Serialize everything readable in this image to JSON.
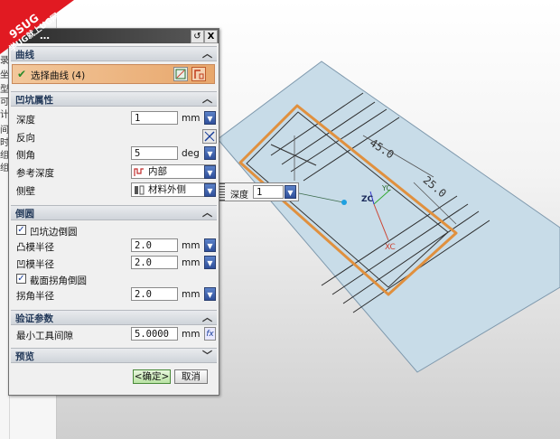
{
  "dialog": {
    "title": "…",
    "close_label": "X",
    "reset_label": "↺",
    "sections": {
      "curve": {
        "label": "曲线"
      },
      "properties": {
        "label": "凹坑属性"
      },
      "fillet": {
        "label": "倒圆"
      },
      "verify": {
        "label": "验证参数"
      },
      "preview": {
        "label": "预览"
      }
    },
    "select_curve": {
      "label": "选择曲线 (4)"
    },
    "depth": {
      "label": "深度",
      "value": "1",
      "unit": "mm"
    },
    "reverse": {
      "label": "反向"
    },
    "side_angle": {
      "label": "侧角",
      "value": "5",
      "unit": "deg"
    },
    "ref_depth": {
      "label": "参考深度",
      "value": "内部"
    },
    "side_wall": {
      "label": "侧壁",
      "value": "材料外侧"
    },
    "fillet_edges": {
      "label": "凹坑边倒圆",
      "checked": true
    },
    "punch_radius": {
      "label": "凸模半径",
      "value": "2.0",
      "unit": "mm"
    },
    "die_radius": {
      "label": "凹模半径",
      "value": "2.0",
      "unit": "mm"
    },
    "fillet_corners": {
      "label": "截面拐角倒圆",
      "checked": true
    },
    "corner_radius": {
      "label": "拐角半径",
      "value": "2.0",
      "unit": "mm"
    },
    "min_clearance": {
      "label": "最小工具间隙",
      "value": "5.0000",
      "unit": "mm"
    },
    "ok_label": "<确定>",
    "cancel_label": "取消"
  },
  "depth_popup": {
    "label": "深度",
    "value": "1"
  },
  "viewport": {
    "dim_length": "45.0",
    "dim_width": "25.0",
    "axis_zc": "ZC",
    "axis_yc": "YC",
    "axis_xc": "XC"
  },
  "left_panel": {
    "chars": [
      "实",
      "录",
      "坐",
      "型",
      "可",
      "计",
      "间",
      "时",
      "组",
      "组"
    ]
  },
  "watermark": {
    "line1": "9SUG",
    "line2": "学UG就上UG网"
  }
}
